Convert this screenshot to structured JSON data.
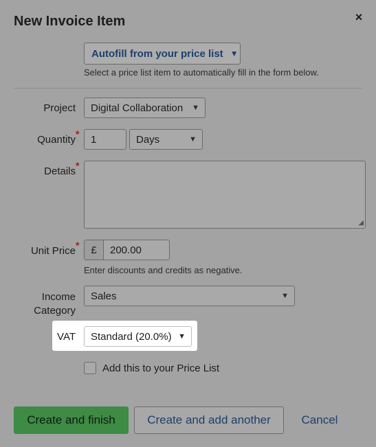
{
  "dialog": {
    "title": "New Invoice Item",
    "close_icon": "×"
  },
  "autofill": {
    "label": "Autofill from your price list",
    "hint": "Select a price list item to automatically fill in the form below."
  },
  "form": {
    "project": {
      "label": "Project",
      "value": "Digital Collaboration"
    },
    "quantity": {
      "label": "Quantity",
      "value": "1",
      "unit": "Days"
    },
    "details": {
      "label": "Details",
      "value": ""
    },
    "unit_price": {
      "label": "Unit Price",
      "currency": "£",
      "value": "200.00",
      "hint": "Enter discounts and credits as negative."
    },
    "income_category": {
      "label_line1": "Income",
      "label_line2": "Category",
      "value": "Sales"
    },
    "vat": {
      "label": "VAT",
      "value": "Standard (20.0%)"
    },
    "price_list_checkbox": {
      "label": "Add this to your Price List",
      "checked": false
    },
    "required_marker": "*"
  },
  "actions": {
    "create_finish": "Create and finish",
    "create_another": "Create and add another",
    "cancel": "Cancel"
  },
  "icons": {
    "chevron": "chevron-down-icon",
    "close": "close-icon"
  }
}
